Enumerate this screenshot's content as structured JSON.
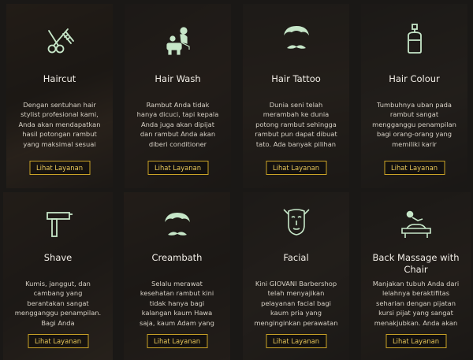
{
  "services": [
    {
      "title": "Haircut",
      "icon": "scissors-comb-icon",
      "description": "Dengan sentuhan hair stylist profesional kami, Anda akan mendapatkan hasil potongan rambut yang maksimal sesuai",
      "button": "Lihat Layanan"
    },
    {
      "title": "Hair Wash",
      "icon": "hair-wash-icon",
      "description": "Rambut Anda tidak hanya dicuci, tapi kepala Anda juga akan dipijat dan rambut Anda akan diberi conditioner",
      "button": "Lihat Layanan"
    },
    {
      "title": "Hair Tattoo",
      "icon": "hair-mustache-icon",
      "description": "Dunia seni telah merambah ke dunia potong rambut sehingga rambut pun dapat dibuat tato. Ada banyak pilihan",
      "button": "Lihat Layanan"
    },
    {
      "title": "Hair Colour",
      "icon": "dye-bottle-icon",
      "description": "Tumbuhnya uban pada rambut sangat mengganggu penampilan bagi orang-orang yang memiliki karir",
      "button": "Lihat Layanan"
    },
    {
      "title": "Shave",
      "icon": "razor-icon",
      "description": "Kumis, janggut, dan cambang yang berantakan sangat mengganggu penampilan. Bagi Anda",
      "button": "Lihat Layanan"
    },
    {
      "title": "Creambath",
      "icon": "hair-mustache-icon",
      "description": "Selalu merawat kesehatan rambut kini tidak hanya bagi kalangan kaum Hawa saja, kaum Adam yang",
      "button": "Lihat Layanan"
    },
    {
      "title": "Facial",
      "icon": "face-mask-icon",
      "description": "Kini GIOVANI Barbershop telah menyajikan pelayanan facial bagi kaum pria yang menginginkan perawatan",
      "button": "Lihat Layanan"
    },
    {
      "title": "Back Massage with Chair",
      "icon": "massage-icon",
      "description": "Manjakan tubuh Anda dari lelahnya beraktifitas seharian dengan pijatan kursi pijat yang sangat menakjubkan. Anda akan",
      "button": "Lihat Layanan"
    }
  ],
  "colors": {
    "accent": "#c9a227",
    "icon": "#c6e6c8",
    "text": "#e8e3da"
  }
}
